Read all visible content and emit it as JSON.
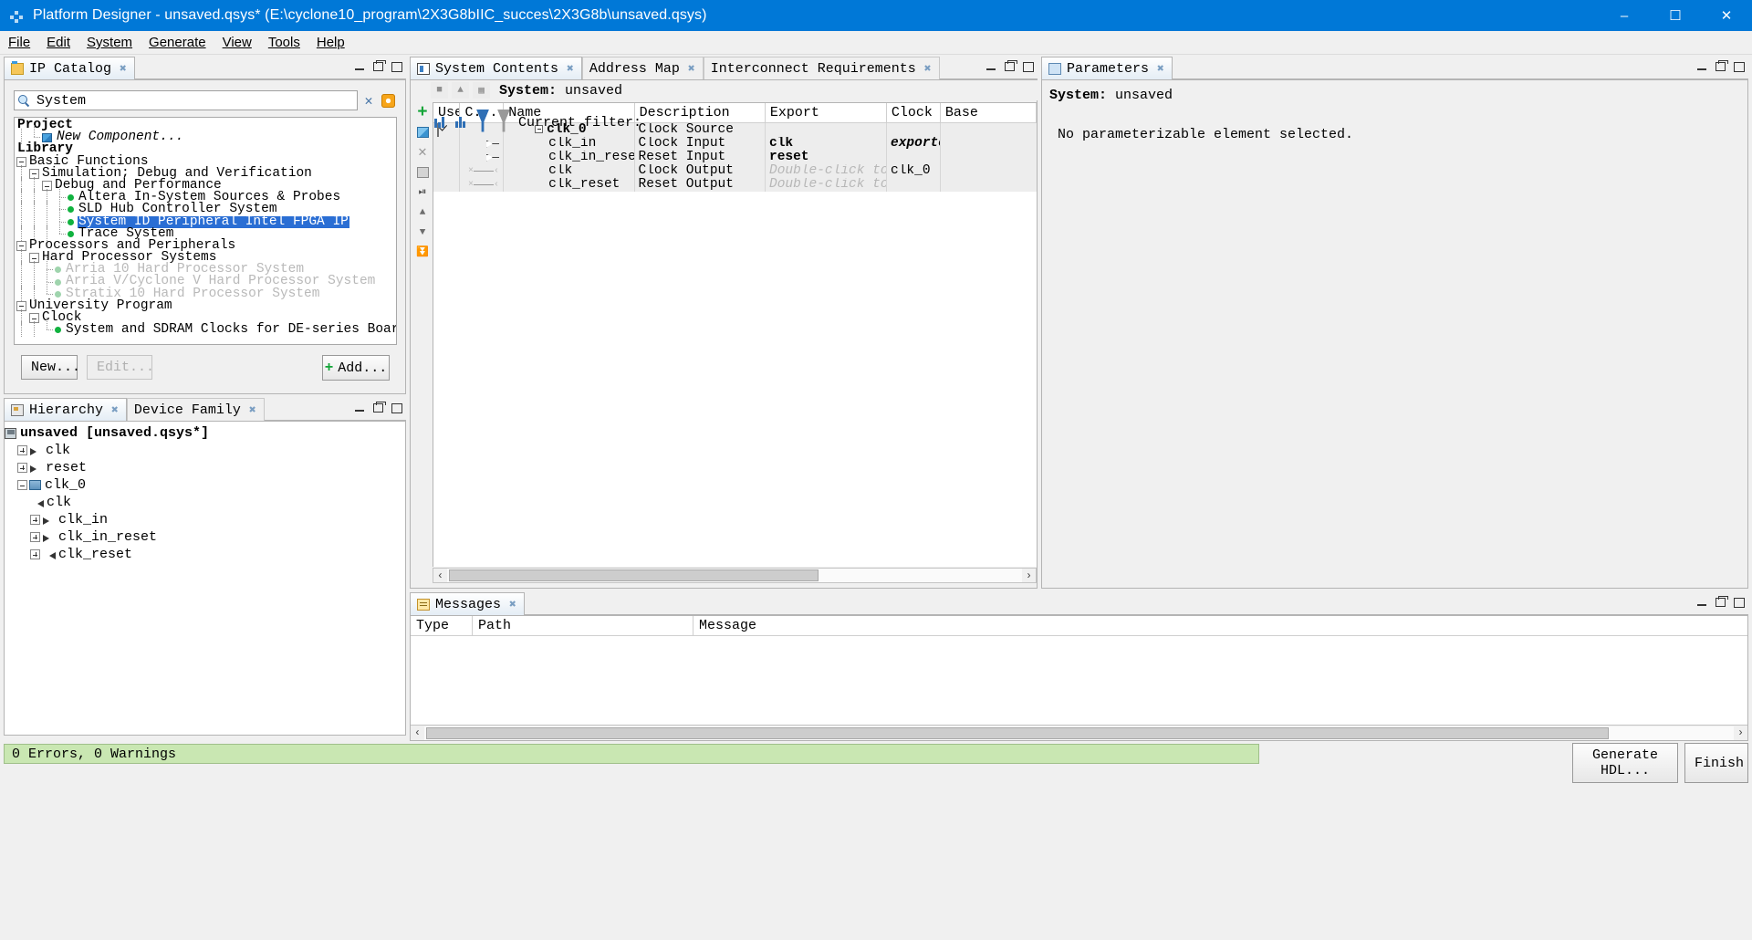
{
  "window": {
    "title": "Platform Designer - unsaved.qsys* (E:\\cyclone10_program\\2X3G8bIIC_succes\\2X3G8b\\unsaved.qsys)",
    "app_icon": "platform-designer-icon",
    "minimize": "–",
    "maximize": "☐",
    "close": "✕"
  },
  "menubar": {
    "items": [
      "File",
      "Edit",
      "System",
      "Generate",
      "View",
      "Tools",
      "Help"
    ]
  },
  "ip_catalog": {
    "tab_label": "IP Catalog",
    "search": {
      "value": "System",
      "placeholder": "System"
    },
    "clear_label": "✕",
    "buttons": {
      "new": "New...",
      "edit": "Edit...",
      "add": "Add..."
    },
    "tree": [
      {
        "depth": 0,
        "label": "Project",
        "style": "bold",
        "node": "none"
      },
      {
        "depth": 1,
        "label": "New Component...",
        "style": "italic",
        "node": "leaf-comp"
      },
      {
        "depth": 0,
        "label": "Library",
        "style": "bold",
        "node": "none"
      },
      {
        "depth": 0,
        "label": "Basic Functions",
        "style": "plain",
        "node": "expanded"
      },
      {
        "depth": 1,
        "label": "Simulation; Debug and Verification",
        "style": "plain",
        "node": "expanded"
      },
      {
        "depth": 2,
        "label": "Debug and Performance",
        "style": "plain",
        "node": "expanded"
      },
      {
        "depth": 3,
        "label": "Altera In-System Sources & Probes",
        "style": "plain",
        "node": "leaf-dot"
      },
      {
        "depth": 3,
        "label": "SLD Hub Controller System",
        "style": "plain",
        "node": "leaf-dot"
      },
      {
        "depth": 3,
        "label": "System ID Peripheral Intel FPGA IP",
        "style": "selected",
        "node": "leaf-dot"
      },
      {
        "depth": 3,
        "label": "Trace System",
        "style": "plain",
        "node": "leaf-dot-last"
      },
      {
        "depth": 0,
        "label": "Processors and Peripherals",
        "style": "plain",
        "node": "expanded"
      },
      {
        "depth": 1,
        "label": "Hard Processor Systems",
        "style": "plain",
        "node": "expanded"
      },
      {
        "depth": 2,
        "label": "Arria 10 Hard Processor System",
        "style": "dim",
        "node": "leaf-dot-dim"
      },
      {
        "depth": 2,
        "label": "Arria V/Cyclone V Hard Processor System",
        "style": "dim",
        "node": "leaf-dot-dim"
      },
      {
        "depth": 2,
        "label": "Stratix 10 Hard Processor System",
        "style": "dim",
        "node": "leaf-dot-dim-last"
      },
      {
        "depth": 0,
        "label": "University Program",
        "style": "plain",
        "node": "expanded"
      },
      {
        "depth": 1,
        "label": "Clock",
        "style": "plain",
        "node": "expanded"
      },
      {
        "depth": 2,
        "label": "System and SDRAM Clocks for DE-series Boards",
        "style": "plain",
        "node": "leaf-dot-last"
      }
    ]
  },
  "hierarchy": {
    "tabs": [
      {
        "label": "Hierarchy",
        "active": true,
        "icon": "hierarchy-icon"
      },
      {
        "label": "Device Family",
        "active": false,
        "icon": "device-family-icon"
      }
    ],
    "tree": [
      {
        "depth": 0,
        "label": "unsaved [unsaved.qsys*]",
        "icon": "system-icon",
        "bold": true,
        "expander": "none"
      },
      {
        "depth": 1,
        "label": "clk",
        "icon": "port-in-icon",
        "bold": false,
        "expander": "plus"
      },
      {
        "depth": 1,
        "label": "reset",
        "icon": "port-in-icon",
        "bold": false,
        "expander": "plus"
      },
      {
        "depth": 1,
        "label": "clk_0",
        "icon": "module-icon",
        "bold": false,
        "expander": "minus"
      },
      {
        "depth": 2,
        "label": "clk",
        "icon": "port-out-icon",
        "bold": false,
        "expander": "none"
      },
      {
        "depth": 2,
        "label": "clk_in",
        "icon": "port-in-icon",
        "bold": false,
        "expander": "plus"
      },
      {
        "depth": 2,
        "label": "clk_in_reset",
        "icon": "port-in-icon",
        "bold": false,
        "expander": "plus"
      },
      {
        "depth": 2,
        "label": "clk_reset",
        "icon": "port-out-icon",
        "bold": false,
        "expander": "plus"
      }
    ]
  },
  "system_contents": {
    "tabs": [
      {
        "label": "System Contents",
        "active": true,
        "icon": "system-contents-icon"
      },
      {
        "label": "Address Map",
        "active": false,
        "icon": ""
      },
      {
        "label": "Interconnect Requirements",
        "active": false,
        "icon": ""
      }
    ],
    "system_label": "System:",
    "system_name": "unsaved",
    "columns": [
      "Use",
      "C...",
      "Name",
      "Description",
      "Export",
      "Clock",
      "Base"
    ],
    "rows": [
      {
        "use": true,
        "conn": "expand",
        "name": "clk_0",
        "bold": true,
        "indent": 0,
        "description": "Clock Source",
        "export": "",
        "export_hint": false,
        "clock": "",
        "base": ""
      },
      {
        "use": false,
        "conn": "port-in",
        "name": "clk_in",
        "bold": false,
        "indent": 1,
        "description": "Clock Input",
        "export": "clk",
        "export_hint": false,
        "clock": "exported",
        "base": ""
      },
      {
        "use": false,
        "conn": "port-in",
        "name": "clk_in_reset",
        "bold": false,
        "indent": 1,
        "description": "Reset Input",
        "export": "reset",
        "export_hint": false,
        "clock": "",
        "base": ""
      },
      {
        "use": false,
        "conn": "port-out",
        "name": "clk",
        "bold": false,
        "indent": 1,
        "description": "Clock Output",
        "export": "Double-click to",
        "export_hint": true,
        "clock": "clk_0",
        "base": ""
      },
      {
        "use": false,
        "conn": "port-out",
        "name": "clk_reset",
        "bold": false,
        "indent": 1,
        "description": "Reset Output",
        "export": "Double-click to",
        "export_hint": true,
        "clock": "",
        "base": ""
      }
    ],
    "filter_label": "Current filter:",
    "filter_value": ""
  },
  "parameters": {
    "tab_label": "Parameters",
    "system_label": "System:",
    "system_name": "unsaved",
    "empty_message": "No parameterizable element selected."
  },
  "messages": {
    "tab_label": "Messages",
    "columns": [
      "Type",
      "Path",
      "Message"
    ],
    "rows": []
  },
  "statusbar": {
    "text": "0 Errors, 0 Warnings"
  },
  "bottom_buttons": {
    "generate": "Generate HDL...",
    "finish": "Finish"
  },
  "colors": {
    "titlebar": "#0078d7",
    "selection": "#2a6ed4",
    "status_ok": "#c9e7b2",
    "leaf_dot": "#10b23f",
    "hint_text": "#b7b7b7"
  }
}
